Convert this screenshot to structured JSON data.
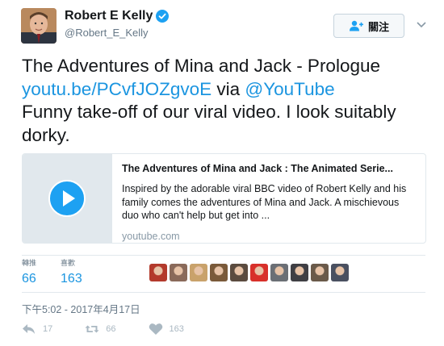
{
  "user": {
    "name": "Robert E Kelly",
    "handle": "@Robert_E_Kelly",
    "verified": true
  },
  "follow_button": {
    "label": "關注",
    "icon": "add-user-icon"
  },
  "caret_icon": "chevron-down-icon",
  "tweet": {
    "line1": "The Adventures of Mina and Jack - Prologue",
    "link": "youtu.be/PCvfJOZgvoE",
    "via": " via ",
    "mention": "@YouTube",
    "line3": "Funny take-off of our viral video. I look suitably dorky."
  },
  "card": {
    "title": "The Adventures of Mina and Jack : The Animated Serie...",
    "description": "Inspired by the adorable viral BBC video of Robert Kelly and his family comes the adventures of Mina and Jack. A mischievous duo who can't help but get into ...",
    "domain": "youtube.com",
    "icon": "play-icon"
  },
  "stats": {
    "retweets_label": "轉推",
    "retweets": "66",
    "likes_label": "喜歡",
    "likes": "163"
  },
  "liker_avatar_colors": [
    "#b33a2c",
    "#8a6a5a",
    "#c9a26b",
    "#7a5a3a",
    "#5b4b3f",
    "#d8302a",
    "#6b6f75",
    "#3f3f44",
    "#6a5a4a",
    "#4a5060"
  ],
  "timestamp": "下午5:02 - 2017年4月17日",
  "actions": {
    "reply_count": "17",
    "retweet_count": "66",
    "like_count": "163"
  }
}
